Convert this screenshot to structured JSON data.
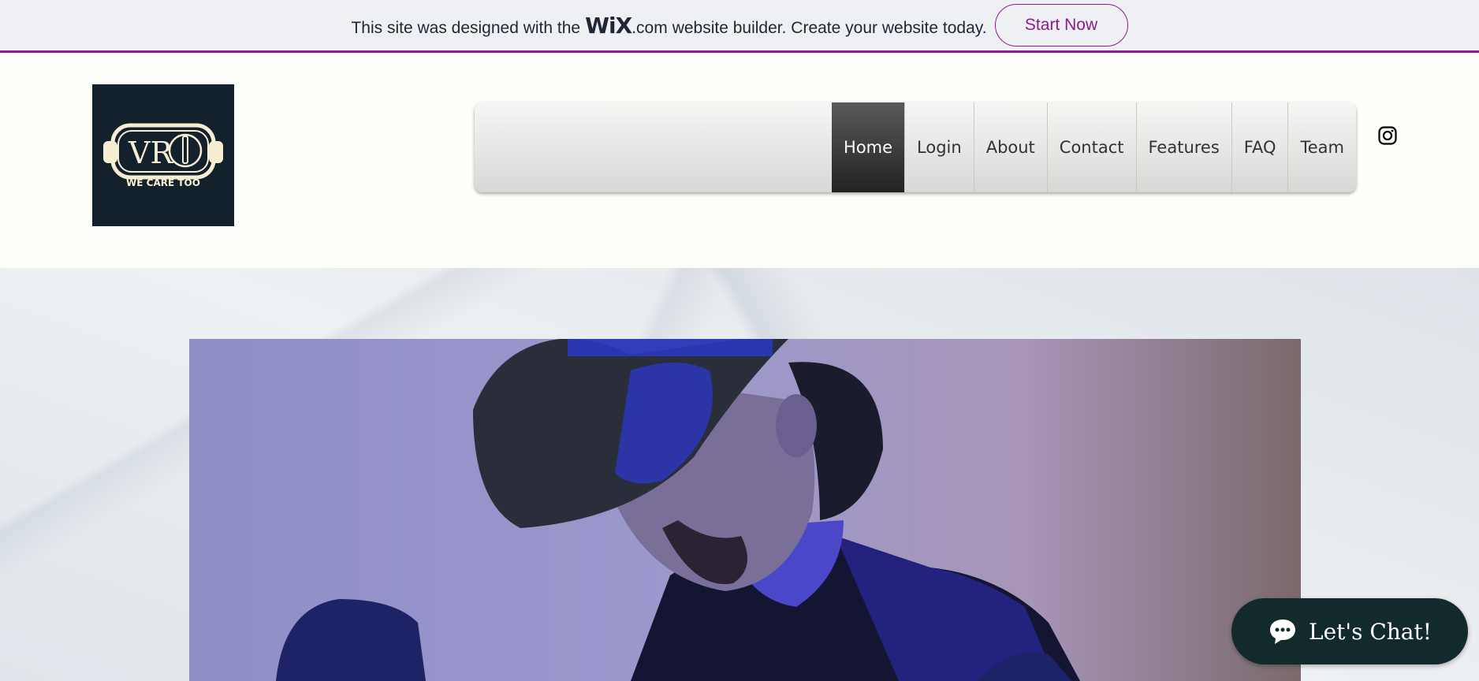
{
  "banner": {
    "text_before": "This site was designed with the",
    "wix_logo": "WiX",
    "wix_domain": ".com",
    "text_after": "website builder. Create your website today.",
    "start_button": "Start Now",
    "accent_color": "#8c1c8f"
  },
  "logo": {
    "mark": "VR",
    "tagline": "WE CARE TOO"
  },
  "nav": {
    "items": [
      {
        "label": "Home",
        "active": true
      },
      {
        "label": "Login"
      },
      {
        "label": "About"
      },
      {
        "label": "Contact"
      },
      {
        "label": "Features"
      },
      {
        "label": "FAQ"
      },
      {
        "label": "Team"
      }
    ]
  },
  "social": {
    "icon": "instagram-icon"
  },
  "chat": {
    "label": "Let's Chat!",
    "icon": "chat-bubble-icon"
  }
}
